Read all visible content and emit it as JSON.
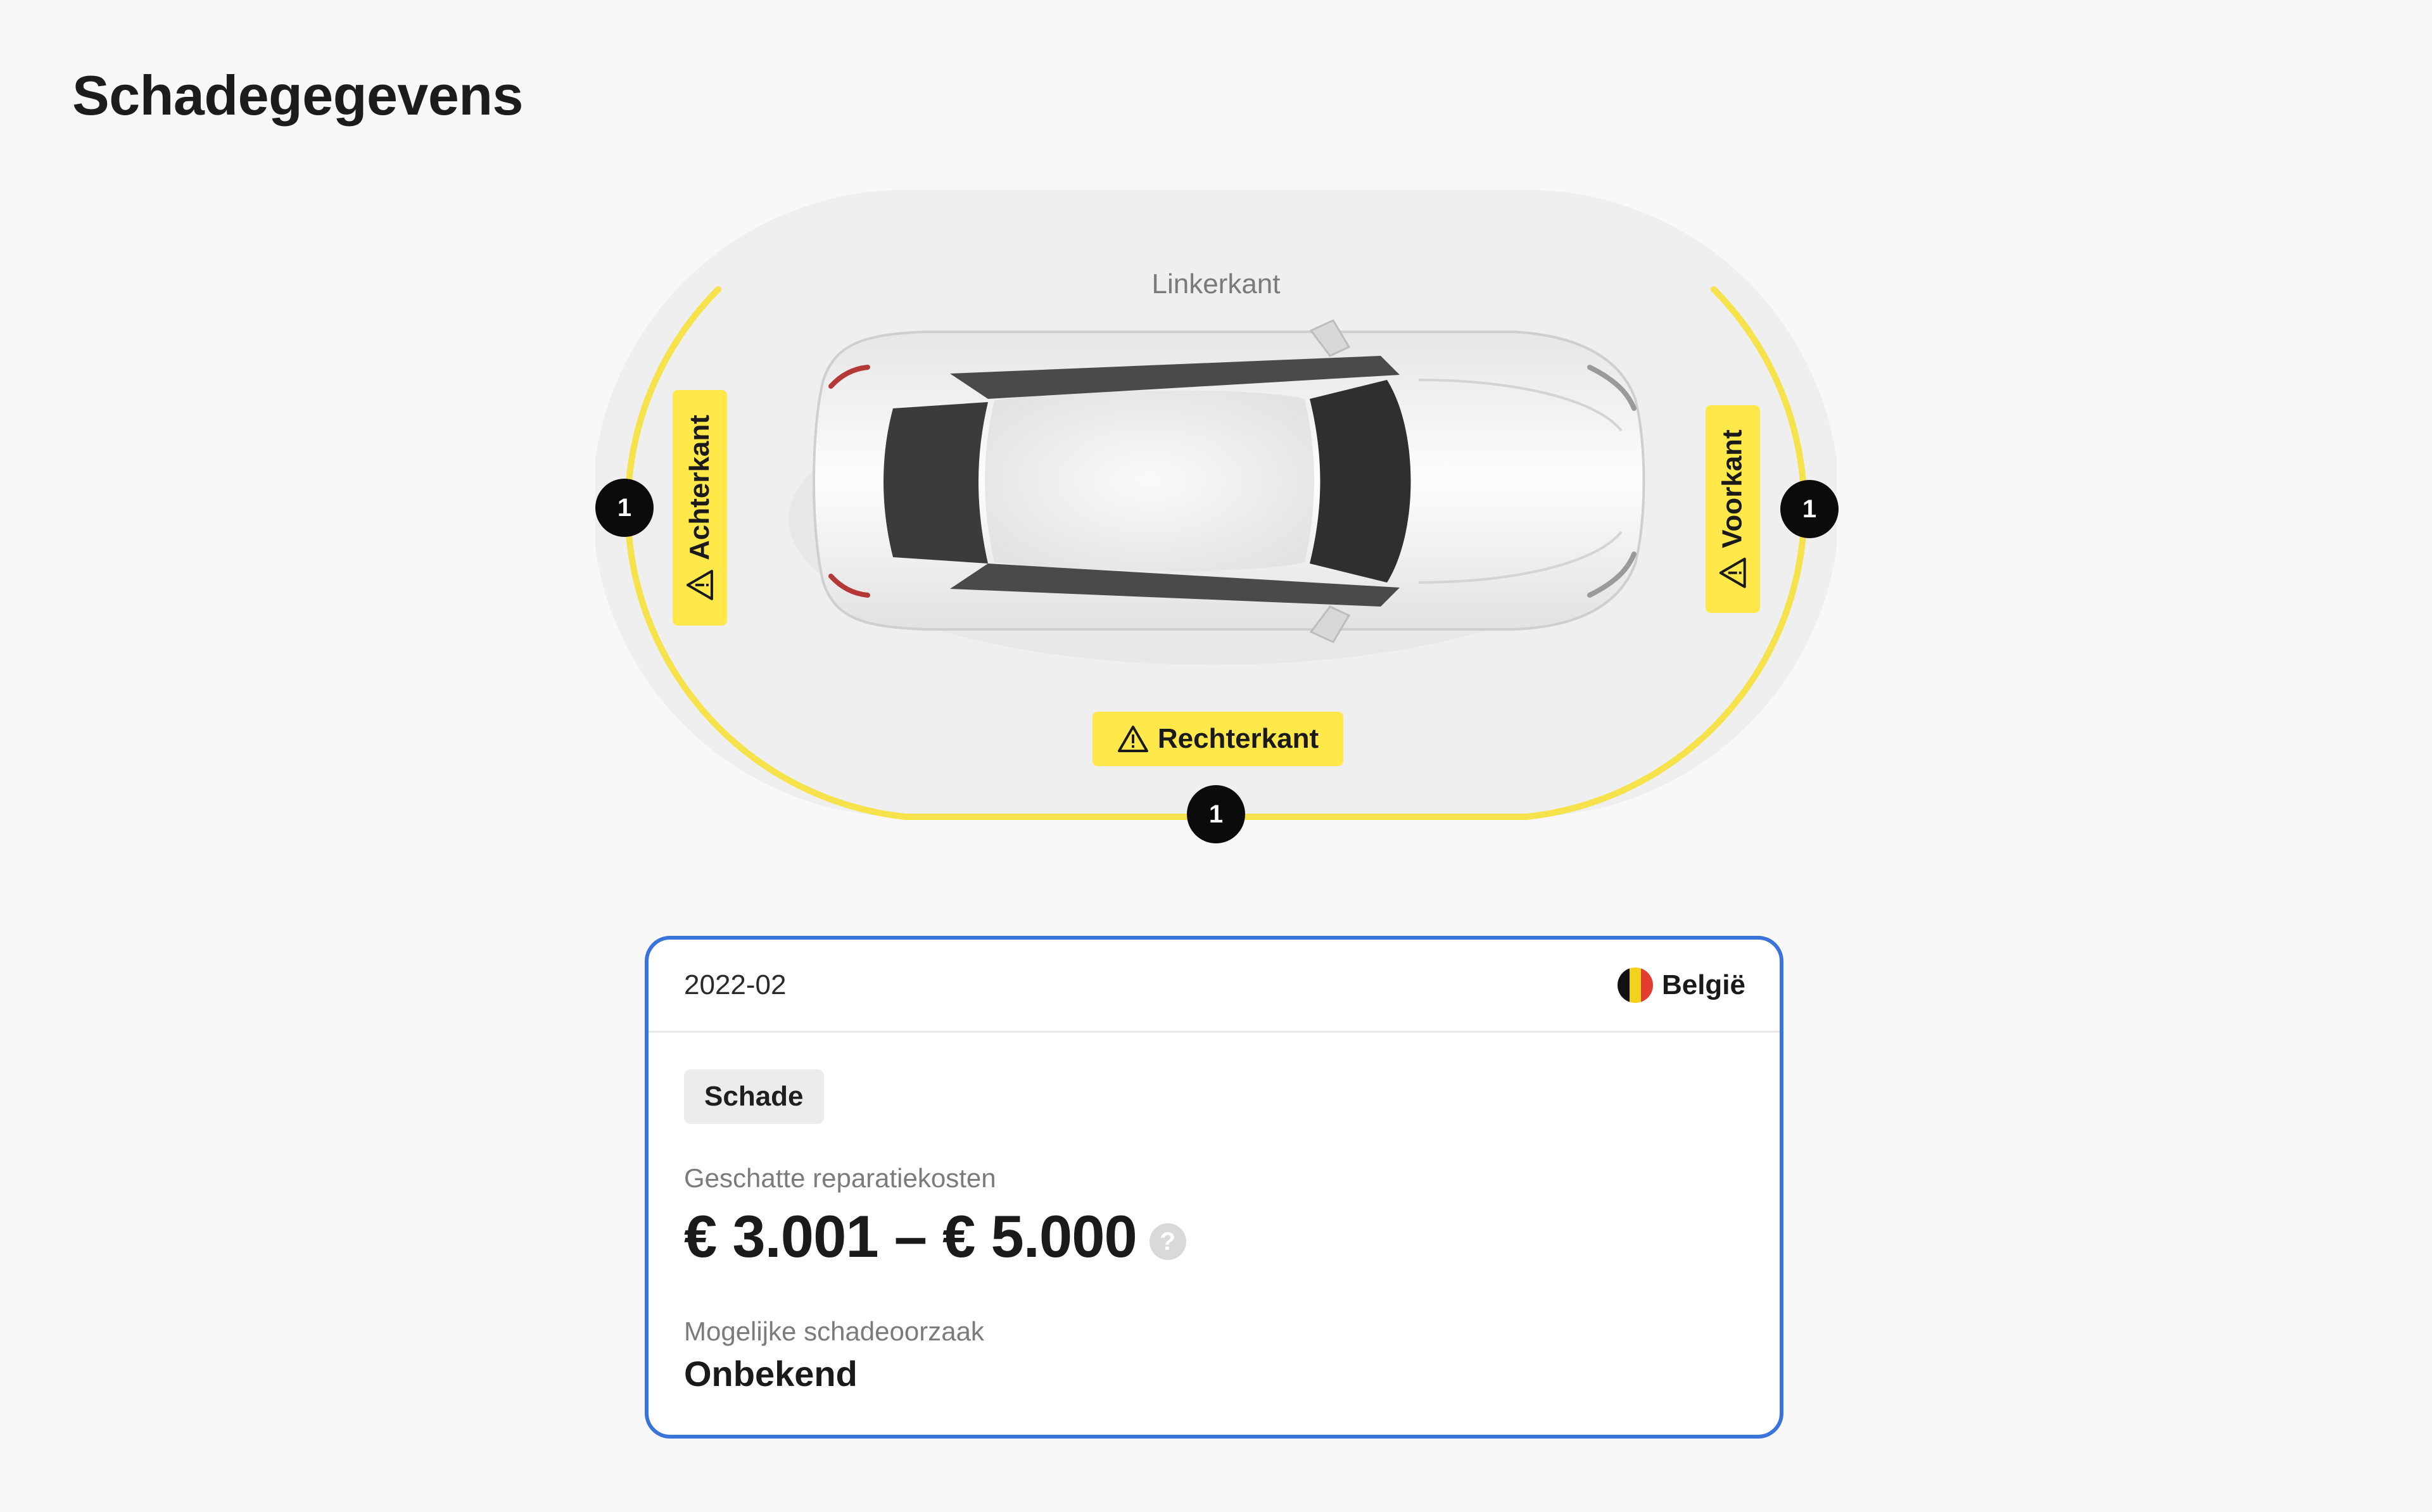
{
  "page": {
    "title": "Schadegegevens"
  },
  "diagram": {
    "top_label": "Linkerkant",
    "zones": {
      "rear": {
        "label": "Achterkant",
        "count": "1"
      },
      "front": {
        "label": "Voorkant",
        "count": "1"
      },
      "right": {
        "label": "Rechterkant",
        "count": "1"
      }
    },
    "highlight_color": "#ffe94a",
    "ring_color": "#f6e24a"
  },
  "card": {
    "date": "2022-02",
    "country": "België",
    "country_flag_colors": [
      "#111111",
      "#f3d21c",
      "#e23b2f"
    ],
    "type_chip": "Schade",
    "cost_label": "Geschatte reparatiekosten",
    "cost_value": "€ 3.001 – € 5.000",
    "help_icon": "?",
    "cause_label": "Mogelijke schadeoorzaak",
    "cause_value": "Onbekend",
    "border_color": "#3a74db"
  }
}
